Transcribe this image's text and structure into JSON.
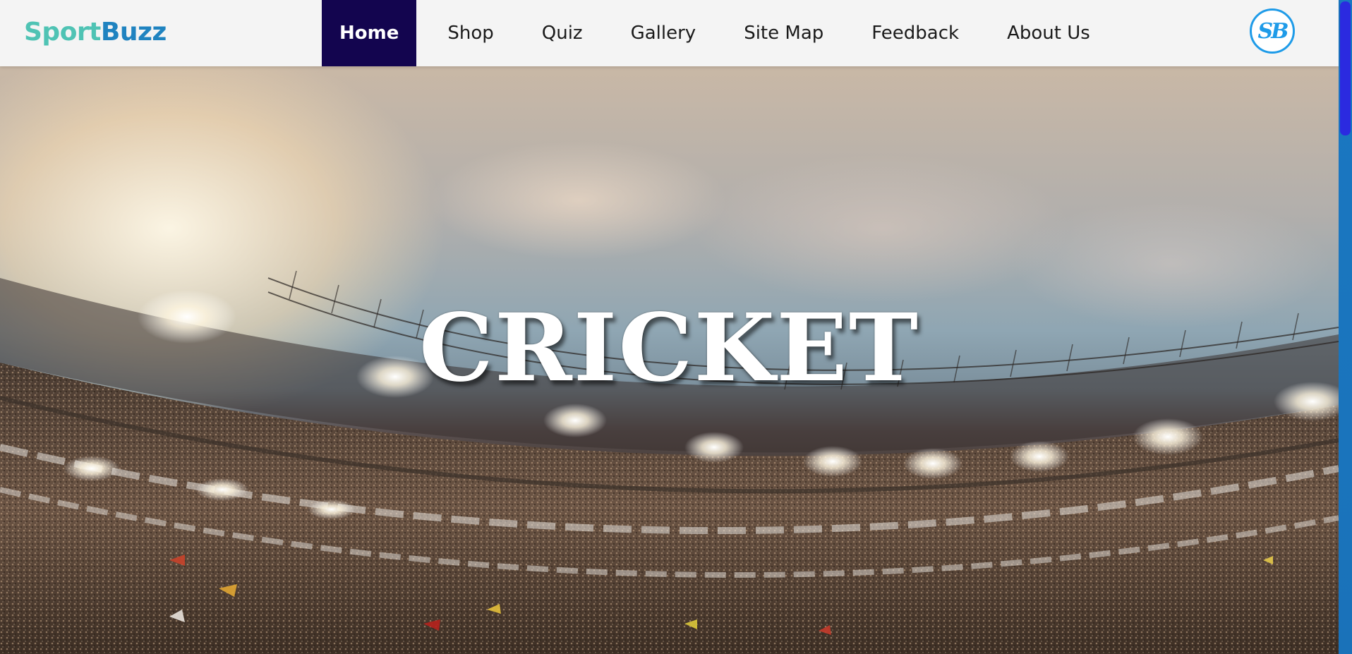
{
  "brand": {
    "name_part1": "Sport",
    "name_part2": "Buzz",
    "color_part1": "#4fc3b4",
    "color_part2": "#1f83c0",
    "badge_text": "SB"
  },
  "nav": {
    "active_color": "#13054f",
    "items": [
      {
        "label": "Home",
        "active": true
      },
      {
        "label": "Shop",
        "active": false
      },
      {
        "label": "Quiz",
        "active": false
      },
      {
        "label": "Gallery",
        "active": false
      },
      {
        "label": "Site Map",
        "active": false
      },
      {
        "label": "Feedback",
        "active": false
      },
      {
        "label": "About Us",
        "active": false
      }
    ]
  },
  "hero": {
    "title": "CRICKET",
    "background": "cricket-stadium-image"
  },
  "scrollbar": {
    "track_color": "#1a78c2",
    "thumb_color": "#2b2ae0"
  }
}
